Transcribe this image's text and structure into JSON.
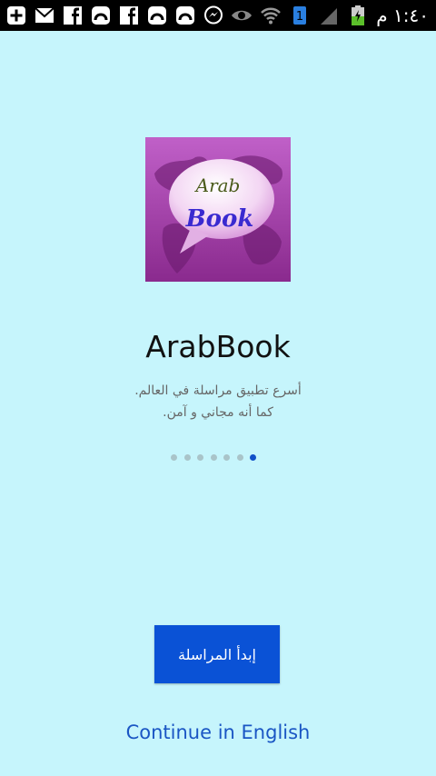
{
  "status_bar": {
    "time": "١:٤٠ م",
    "left_icons": [
      "plus-icon",
      "mail-icon",
      "facebook-icon",
      "app-icon",
      "facebook-icon",
      "app-icon",
      "app-icon",
      "messenger-icon"
    ],
    "right_icons": [
      "eye-icon",
      "wifi-icon",
      "sim-icon",
      "signal-icon",
      "battery-icon"
    ]
  },
  "logo": {
    "line1": "Arab",
    "line2": "Book"
  },
  "app": {
    "name": "ArabBook",
    "tagline_line1": "أسرع تطبيق مراسلة في العالم.",
    "tagline_line2": "كما أنه مجاني و آمن."
  },
  "pager": {
    "count": 7,
    "active_index": 6
  },
  "actions": {
    "start_label": "إبدأ المراسلة",
    "english_link": "Continue in English"
  },
  "colors": {
    "background": "#c6f5fc",
    "primary_button": "#0a52d6",
    "link": "#1a56c4",
    "active_dot": "#1050c8"
  }
}
